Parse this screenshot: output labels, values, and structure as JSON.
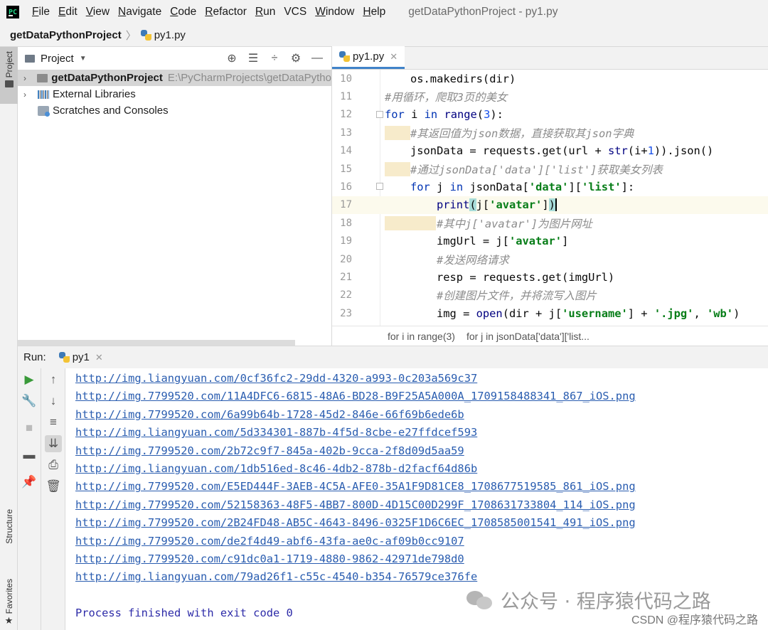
{
  "menubar": {
    "logo": "PC",
    "items": [
      {
        "label": "File",
        "u": "F",
        "rest": "ile"
      },
      {
        "label": "Edit",
        "u": "E",
        "rest": "dit"
      },
      {
        "label": "View",
        "u": "V",
        "rest": "iew"
      },
      {
        "label": "Navigate",
        "u": "N",
        "rest": "avigate"
      },
      {
        "label": "Code",
        "u": "C",
        "rest": "ode"
      },
      {
        "label": "Refactor",
        "u": "R",
        "rest": "efactor"
      },
      {
        "label": "Run",
        "u": "R",
        "rest": "un"
      },
      {
        "label": "VCS",
        "u": "",
        "rest": "VCS"
      },
      {
        "label": "Window",
        "u": "W",
        "rest": "indow"
      },
      {
        "label": "Help",
        "u": "H",
        "rest": "elp"
      }
    ],
    "window_title": "getDataPythonProject - py1.py"
  },
  "breadcrumb": {
    "project": "getDataPythonProject",
    "file": "py1.py"
  },
  "left_stripe": {
    "project": "Project",
    "structure": "Structure",
    "favorites": "Favorites"
  },
  "project_panel": {
    "title": "Project",
    "tree": [
      {
        "name": "getDataPythonProject",
        "path": "E:\\PyCharmProjects\\getDataPytho"
      },
      {
        "name": "External Libraries"
      },
      {
        "name": "Scratches and Consoles"
      }
    ]
  },
  "editor": {
    "tab": "py1.py",
    "lines": [
      {
        "n": "10"
      },
      {
        "n": "11"
      },
      {
        "n": "12"
      },
      {
        "n": "13"
      },
      {
        "n": "14"
      },
      {
        "n": "15"
      },
      {
        "n": "16"
      },
      {
        "n": "17"
      },
      {
        "n": "18"
      },
      {
        "n": "19"
      },
      {
        "n": "20"
      },
      {
        "n": "21"
      },
      {
        "n": "22"
      },
      {
        "n": "23"
      }
    ],
    "code": {
      "l10": "os.makedirs(dir)",
      "l11": "#用循环，爬取3页的美女",
      "l12_for": "for",
      "l12_mid": " i ",
      "l12_in": "in",
      "l12_range": "range",
      "l12_num": "3",
      "l13": "#其返回值为json数据，直接获取其json字典",
      "l14_a": "jsonData = requests.get(url + ",
      "l14_str": "str",
      "l14_b": "(i+",
      "l14_num": "1",
      "l14_c": ")).json()",
      "l15": "#通过jsonData['data']['list']获取美女列表",
      "l16_for": "for",
      "l16_mid": " j ",
      "l16_in": "in",
      "l16_a": " jsonData[",
      "l16_s1": "'data'",
      "l16_b": "][",
      "l16_s2": "'list'",
      "l16_c": "]:",
      "l17_print": "print",
      "l17_a": "j[",
      "l17_s": "'avatar'",
      "l17_b": "]",
      "l18": "#其中j['avatar']为图片网址",
      "l19_a": "imgUrl = j[",
      "l19_s": "'avatar'",
      "l19_b": "]",
      "l20": "#发送网络请求",
      "l21": "resp = requests.get(imgUrl)",
      "l22": "#创建图片文件，并将流写入图片",
      "l23_a": "img = ",
      "l23_open": "open",
      "l23_b": "(dir + j[",
      "l23_s1": "'username'",
      "l23_c": "] + ",
      "l23_s2": "'.jpg'",
      "l23_d": ", ",
      "l23_s3": "'wb'",
      "l23_e": ")"
    },
    "crumbs": [
      "for i in range(3)",
      "for j in jsonData['data']['list..."
    ]
  },
  "run_panel": {
    "label": "Run:",
    "tab": "py1",
    "output": [
      "http://img.liangyuan.com/0cf36fc2-29dd-4320-a993-0c203a569c37",
      "http://img.7799520.com/11A4DFC6-6815-48A6-BD28-B9F25A5A000A_1709158488341_867_iOS.png",
      "http://img.7799520.com/6a99b64b-1728-45d2-846e-66f69b6ede6b",
      "http://img.liangyuan.com/5d334301-887b-4f5d-8cbe-e27ffdcef593",
      "http://img.7799520.com/2b72c9f7-845a-402b-9cca-2f8d09d5aa59",
      "http://img.liangyuan.com/1db516ed-8c46-4db2-878b-d2facf64d86b",
      "http://img.7799520.com/E5ED444F-3AEB-4C5A-AFE0-35A1F9D81CE8_1708677519585_861_iOS.png",
      "http://img.7799520.com/52158363-48F5-4BB7-800D-4D15C00D299F_1708631733804_114_iOS.png",
      "http://img.7799520.com/2B24FD48-AB5C-4643-8496-0325F1D6C6EC_1708585001541_491_iOS.png",
      "http://img.7799520.com/de2f4d49-abf6-43fa-ae0c-af09b0cc9107",
      "http://img.7799520.com/c91dc0a1-1719-4880-9862-42971de798d0",
      "http://img.liangyuan.com/79ad26f1-c55c-4540-b354-76579ce376fe"
    ],
    "exit_message": "Process finished with exit code 0"
  },
  "watermark": {
    "text": "公众号 · 程序猿代码之路",
    "csdn": "CSDN @程序猿代码之路"
  }
}
